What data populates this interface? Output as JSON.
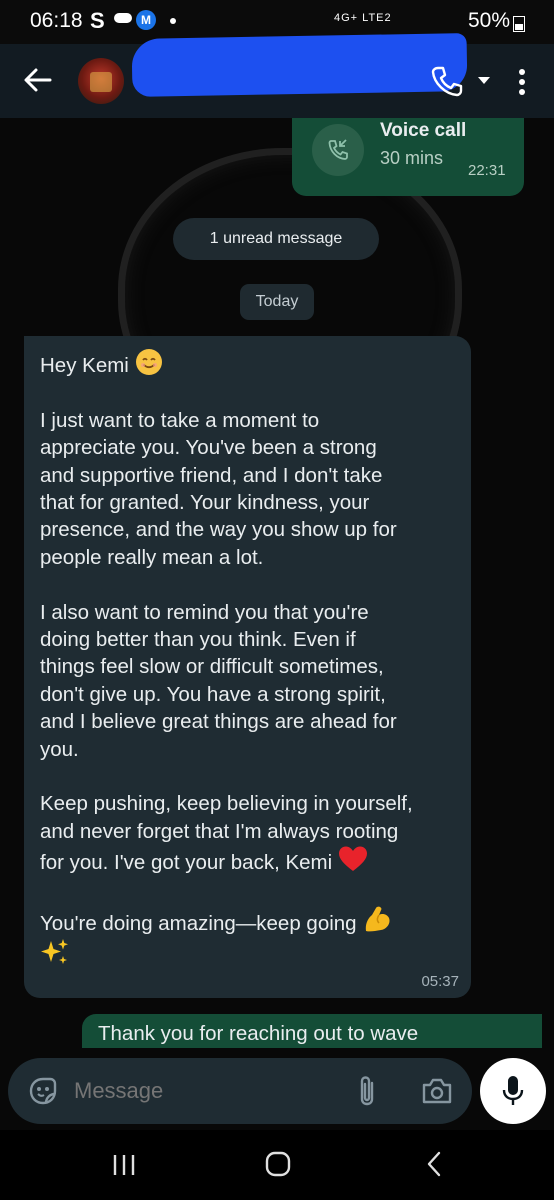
{
  "status_bar": {
    "time": "06:18",
    "s_glyph": "S",
    "m_badge": "M",
    "network_labels": "4G+ LTE2",
    "battery": "50%"
  },
  "header": {
    "contact_name": "",
    "back_icon": "arrow-left-icon",
    "call_icon": "phone-icon",
    "menu_icon": "more-vert-icon"
  },
  "call_log": {
    "title": "Voice call",
    "duration": "30 mins",
    "time": "22:31"
  },
  "unread_label": "1 unread message",
  "date_label": "Today",
  "incoming_message": {
    "greeting": "Hey Kemi",
    "p1_l1": "I just want to take a moment to",
    "p1_l2": "appreciate you. You've been a strong",
    "p1_l3": "and supportive friend, and I don't take",
    "p1_l4": "that for granted. Your kindness, your",
    "p1_l5": "presence, and the way you show up for",
    "p1_l6": "people really mean a lot.",
    "p2_l1": "I also want to remind you that you're",
    "p2_l2": "doing better than you think. Even if",
    "p2_l3": "things feel slow or difficult sometimes,",
    "p2_l4": "don't give up. You have a strong spirit,",
    "p2_l5": "and I believe great things are ahead for",
    "p2_l6": "you.",
    "p3_l1": "Keep pushing, keep believing in yourself,",
    "p3_l2": "and never forget that I'm always rooting",
    "p3_l3": "for you. I've got your back, Kemi",
    "p4_l1": "You're doing amazing—keep going",
    "time": "05:37"
  },
  "outgoing_preview": "Thank you for reaching out to wave",
  "composer": {
    "placeholder": "Message"
  },
  "colors": {
    "incoming_bubble": "#1f2c33",
    "outgoing_bubble": "#144d37",
    "app_bar": "#121b22"
  }
}
